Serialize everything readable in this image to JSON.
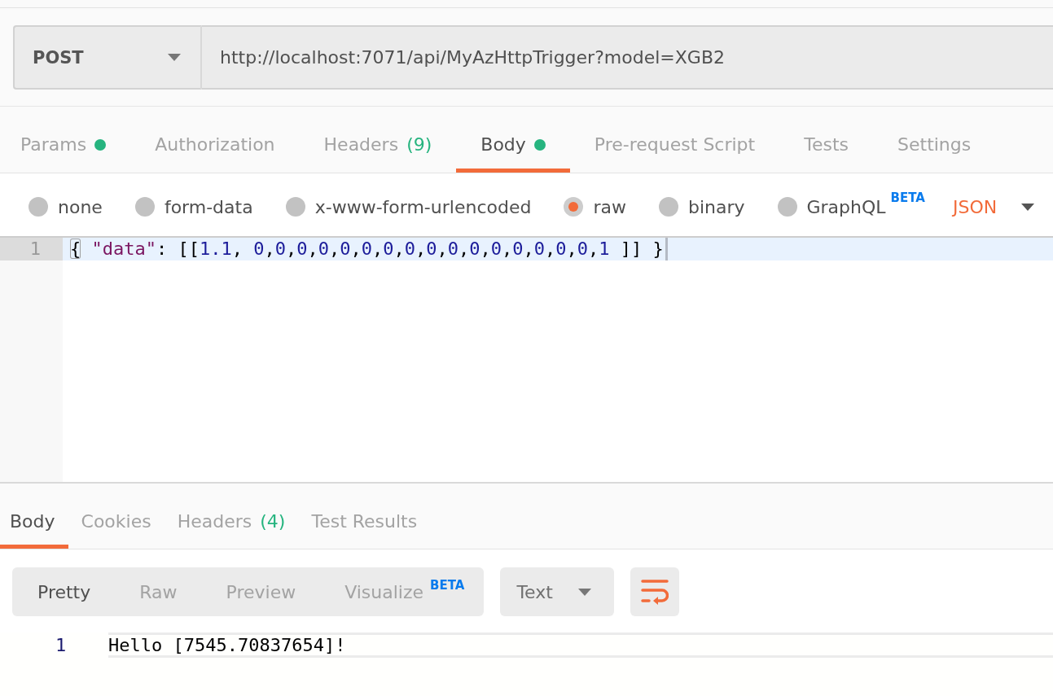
{
  "request_bar": {
    "method": "POST",
    "url": "http://localhost:7071/api/MyAzHttpTrigger?model=XGB2"
  },
  "request_tabs": [
    {
      "label": "Params",
      "selected": false,
      "dot": true
    },
    {
      "label": "Authorization",
      "selected": false,
      "dot": false
    },
    {
      "label": "Headers",
      "count": "(9)",
      "selected": false,
      "dot": false
    },
    {
      "label": "Body",
      "selected": true,
      "dot": true
    },
    {
      "label": "Pre-request Script",
      "selected": false,
      "dot": false
    },
    {
      "label": "Tests",
      "selected": false,
      "dot": false
    },
    {
      "label": "Settings",
      "selected": false,
      "dot": false
    }
  ],
  "body_types": [
    {
      "label": "none",
      "selected": false
    },
    {
      "label": "form-data",
      "selected": false
    },
    {
      "label": "x-www-form-urlencoded",
      "selected": false
    },
    {
      "label": "raw",
      "selected": true
    },
    {
      "label": "binary",
      "selected": false
    },
    {
      "label": "GraphQL",
      "badge": "BETA",
      "selected": false
    }
  ],
  "body_format": "JSON",
  "editor": {
    "lines": [
      {
        "number": "1",
        "code": "{ \"data\": [[1.1, 0,0,0,0,0,0,0,0,0,0,0,0,0,0,0,0,1 ]] }",
        "active": true,
        "cursor": true
      }
    ]
  },
  "response_tabs": [
    {
      "label": "Body",
      "selected": true
    },
    {
      "label": "Cookies",
      "selected": false
    },
    {
      "label": "Headers",
      "count": "(4)",
      "selected": false
    },
    {
      "label": "Test Results",
      "selected": false
    }
  ],
  "response_view": {
    "modes": [
      {
        "label": "Pretty",
        "selected": true
      },
      {
        "label": "Raw",
        "selected": false
      },
      {
        "label": "Preview",
        "selected": false
      },
      {
        "label": "Visualize",
        "badge": "BETA",
        "selected": false
      }
    ],
    "format": "Text",
    "wrap_lines": true
  },
  "response_body": {
    "lines": [
      {
        "number": "1",
        "text": "Hello [7545.70837654]!",
        "active": true
      }
    ]
  }
}
